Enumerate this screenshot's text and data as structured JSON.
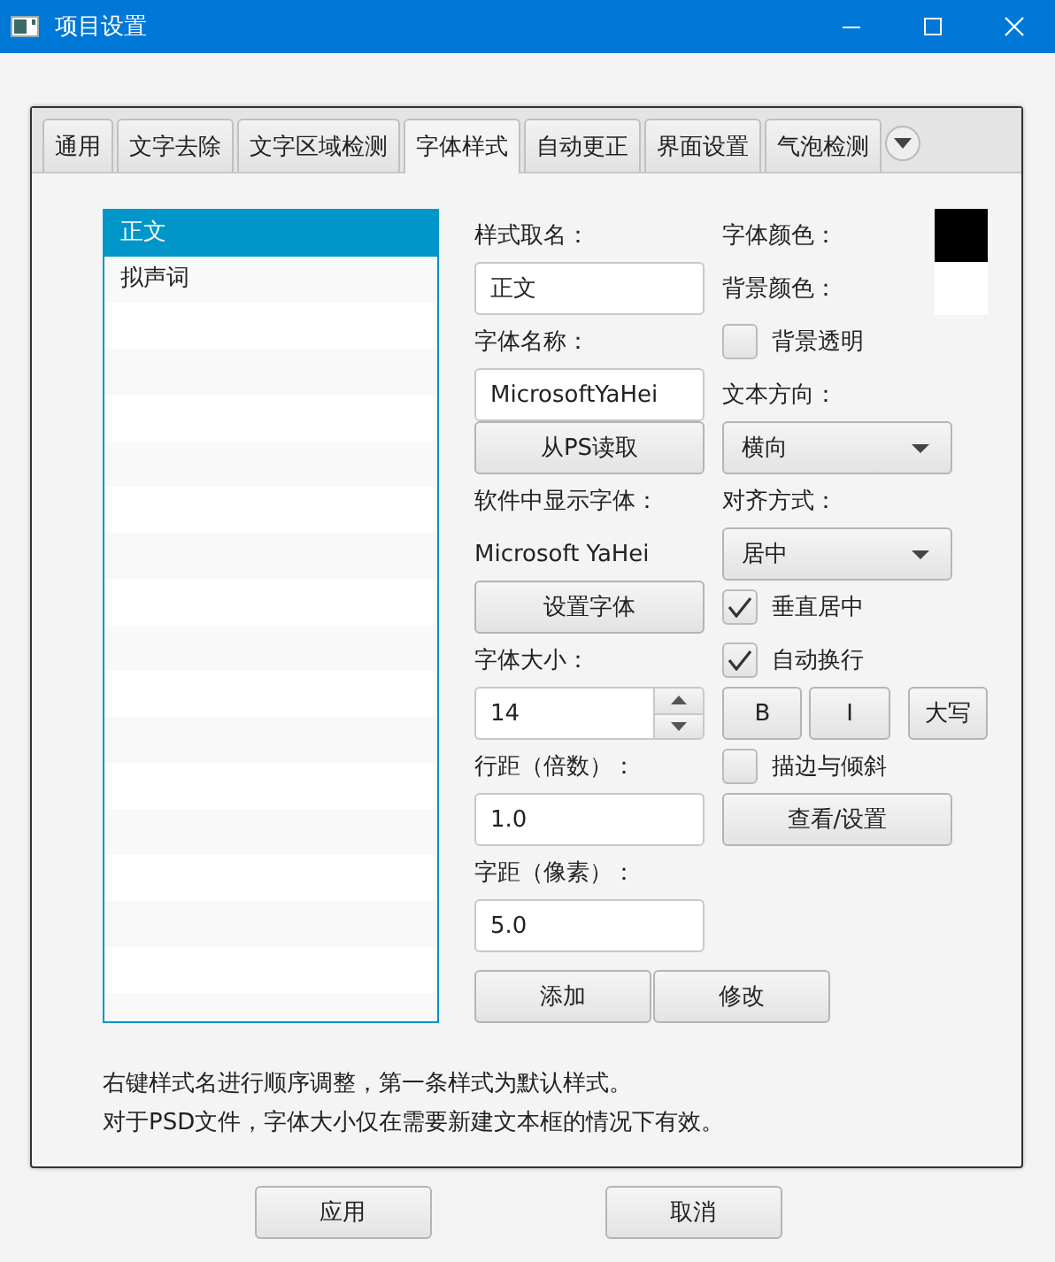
{
  "window": {
    "title": "项目设置"
  },
  "tabs": [
    {
      "label": "通用",
      "selected": false
    },
    {
      "label": "文字去除",
      "selected": false
    },
    {
      "label": "文字区域检测",
      "selected": false
    },
    {
      "label": "字体样式",
      "selected": true
    },
    {
      "label": "自动更正",
      "selected": false
    },
    {
      "label": "界面设置",
      "selected": false
    },
    {
      "label": "气泡检测",
      "selected": false
    }
  ],
  "styles": [
    {
      "name": "正文",
      "selected": true
    },
    {
      "name": "拟声词",
      "selected": false
    }
  ],
  "left_column": [
    {
      "kind": "label",
      "text": "样式取名："
    },
    {
      "kind": "field",
      "value": "正文"
    },
    {
      "kind": "label",
      "text": "字体名称："
    },
    {
      "kind": "field",
      "value": "MicrosoftYaHei"
    },
    {
      "kind": "button",
      "label": "从PS读取"
    },
    {
      "kind": "label",
      "text": "软件中显示字体："
    },
    {
      "kind": "text",
      "text": "Microsoft YaHei"
    },
    {
      "kind": "button",
      "label": "设置字体"
    },
    {
      "kind": "label",
      "text": "字体大小："
    },
    {
      "kind": "spinner",
      "value": "14"
    },
    {
      "kind": "label",
      "text": "行距（倍数）："
    },
    {
      "kind": "field",
      "value": "1.0"
    },
    {
      "kind": "label",
      "text": "字距（像素）："
    },
    {
      "kind": "field",
      "value": "5.0"
    }
  ],
  "right_column": [
    {
      "kind": "color",
      "label": "字体颜色：",
      "color": "#000000"
    },
    {
      "kind": "color",
      "label": "背景颜色：",
      "color": "#ffffff"
    },
    {
      "kind": "checkbox",
      "label": "背景透明",
      "checked": false
    },
    {
      "kind": "label",
      "text": "文本方向："
    },
    {
      "kind": "dropdown",
      "value": "横向"
    },
    {
      "kind": "label",
      "text": "对齐方式："
    },
    {
      "kind": "dropdown",
      "value": "居中"
    },
    {
      "kind": "checkbox",
      "label": "垂直居中",
      "checked": true
    },
    {
      "kind": "checkbox",
      "label": "自动换行",
      "checked": true
    },
    {
      "kind": "format",
      "buttons": [
        "B",
        "I",
        "大写"
      ]
    },
    {
      "kind": "checkbox",
      "label": "描边与倾斜",
      "checked": false
    },
    {
      "kind": "button",
      "label": "查看/设置"
    }
  ],
  "list_buttons": [
    "添加",
    "修改"
  ],
  "notes": [
    "右键样式名进行顺序调整，第一条样式为默认样式。",
    "对于PSD文件，字体大小仅在需要新建文本框的情况下有效。"
  ],
  "buttons": [
    "应用",
    "取消"
  ]
}
